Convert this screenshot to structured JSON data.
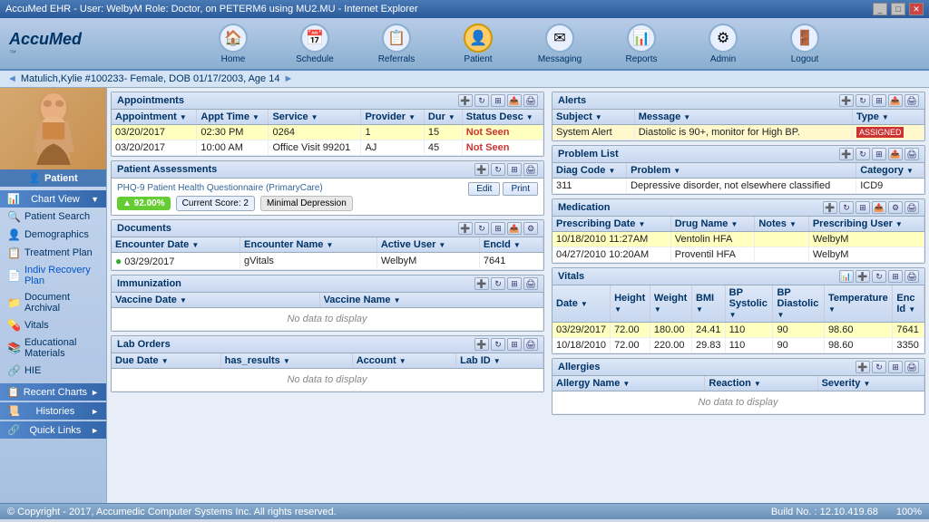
{
  "titleBar": {
    "text": "AccuMed EHR - User: WelbyM Role: Doctor, on PETERM6 using MU2.MU - Internet Explorer",
    "controls": [
      "_",
      "□",
      "✕"
    ]
  },
  "nav": {
    "items": [
      {
        "label": "Home",
        "icon": "🏠",
        "active": false
      },
      {
        "label": "Schedule",
        "icon": "📅",
        "active": false
      },
      {
        "label": "Referrals",
        "icon": "📋",
        "active": false
      },
      {
        "label": "Patient",
        "icon": "👤",
        "active": true
      },
      {
        "label": "Messaging",
        "icon": "✉",
        "active": false
      },
      {
        "label": "Reports",
        "icon": "📊",
        "active": false
      },
      {
        "label": "Admin",
        "icon": "⚙",
        "active": false
      },
      {
        "label": "Logout",
        "icon": "🚪",
        "active": false
      }
    ]
  },
  "patientBar": {
    "text": "Matulich,Kylie #100233- Female, DOB 01/17/2003, Age 14"
  },
  "sidebar": {
    "patientLabel": "Patient",
    "items": [
      {
        "label": "Patient Search",
        "icon": "🔍"
      },
      {
        "label": "Demographics",
        "icon": "👤"
      },
      {
        "label": "Treatment Plan",
        "icon": "📋"
      },
      {
        "label": "Indiv Recovery Plan",
        "icon": "📄"
      },
      {
        "label": "Document Archival",
        "icon": "📁"
      },
      {
        "label": "Vitals",
        "icon": "💊"
      },
      {
        "label": "Educational Materials",
        "icon": "📚"
      },
      {
        "label": "HIE",
        "icon": "🔗"
      }
    ],
    "sections": [
      {
        "label": "Chart View",
        "icon": "📊"
      },
      {
        "label": "Recent Charts",
        "icon": "📋"
      },
      {
        "label": "Histories",
        "icon": "📜"
      },
      {
        "label": "Quick Links",
        "icon": "🔗"
      }
    ]
  },
  "appointments": {
    "title": "Appointments",
    "columns": [
      "Appointment",
      "Appt Time",
      "Service",
      "Provider",
      "Dur",
      "Status Desc"
    ],
    "rows": [
      {
        "date": "03/20/2017",
        "time": "02:30 PM",
        "service": "0264",
        "provider": "1",
        "dur": "15",
        "status": "Not Seen",
        "highlight": true
      },
      {
        "date": "03/20/2017",
        "time": "10:00 AM",
        "service": "Office Visit 99201",
        "provider": "AJ",
        "dur": "45",
        "status": "Not Seen",
        "highlight": false
      }
    ]
  },
  "assessment": {
    "title": "Patient Assessments",
    "phqLabel": "PHQ-9 Patient Health Questionnaire (PrimaryCare)",
    "editBtn": "Edit",
    "printBtn": "Print",
    "scoreUp": "▲ 92.00%",
    "currentScore": "Current Score: 2",
    "scoreLabel": "Minimal Depression"
  },
  "documents": {
    "title": "Documents",
    "columns": [
      "Encounter Date",
      "Encounter Name",
      "Active User",
      "EncId"
    ],
    "rows": [
      {
        "date": "03/29/2017",
        "name": "gVitals",
        "user": "WelbyM",
        "encid": "7641",
        "green": true
      }
    ]
  },
  "immunization": {
    "title": "Immunization",
    "columns": [
      "Vaccine Date",
      "Vaccine Name"
    ],
    "noData": "No data to display"
  },
  "labOrders": {
    "title": "Lab Orders",
    "columns": [
      "Due Date",
      "has_results",
      "Account",
      "Lab ID"
    ],
    "noData": "No data to display"
  },
  "alerts": {
    "title": "Alerts",
    "columns": [
      "Subject",
      "Message",
      "Type"
    ],
    "rows": [
      {
        "subject": "System Alert",
        "message": "Diastolic is 90+, monitor for High BP.",
        "type": "ASSIGNED",
        "highlight": true
      }
    ]
  },
  "problemList": {
    "title": "Problem List",
    "columns": [
      "Diag Code",
      "Problem",
      "Category"
    ],
    "rows": [
      {
        "code": "311",
        "problem": "Depressive disorder, not elsewhere classified",
        "category": "ICD9"
      }
    ]
  },
  "medication": {
    "title": "Medication",
    "columns": [
      "Prescribing Date",
      "Drug Name",
      "Notes",
      "Prescribing User"
    ],
    "rows": [
      {
        "date": "10/18/2010 11:27AM",
        "drug": "Ventolin HFA",
        "notes": "",
        "user": "WelbyM",
        "highlight": true
      },
      {
        "date": "04/27/2010 10:20AM",
        "drug": "Proventil HFA",
        "notes": "",
        "user": "WelbyM",
        "highlight": false
      }
    ]
  },
  "vitals": {
    "title": "Vitals",
    "columns": [
      "Date",
      "Height",
      "Weight",
      "BMI",
      "BP Systolic",
      "BP Diastolic",
      "Temperature",
      "Enc Id"
    ],
    "rows": [
      {
        "date": "03/29/2017",
        "height": "72.00",
        "weight": "180.00",
        "bmi": "24.41",
        "bps": "110",
        "bpd": "90",
        "temp": "98.60",
        "encid": "7641",
        "highlight": true
      },
      {
        "date": "10/18/2010",
        "height": "72.00",
        "weight": "220.00",
        "bmi": "29.83",
        "bps": "110",
        "bpd": "90",
        "temp": "98.60",
        "encid": "3350",
        "highlight": false
      }
    ]
  },
  "allergies": {
    "title": "Allergies",
    "columns": [
      "Allergy Name",
      "Reaction",
      "Severity"
    ],
    "noData": "No data to display"
  },
  "statusBar": {
    "copyright": "© Copyright - 2017, Accumedic Computer Systems Inc. All rights reserved.",
    "buildNo": "Build No. : 12.10.419.68",
    "zoom": "100%"
  }
}
